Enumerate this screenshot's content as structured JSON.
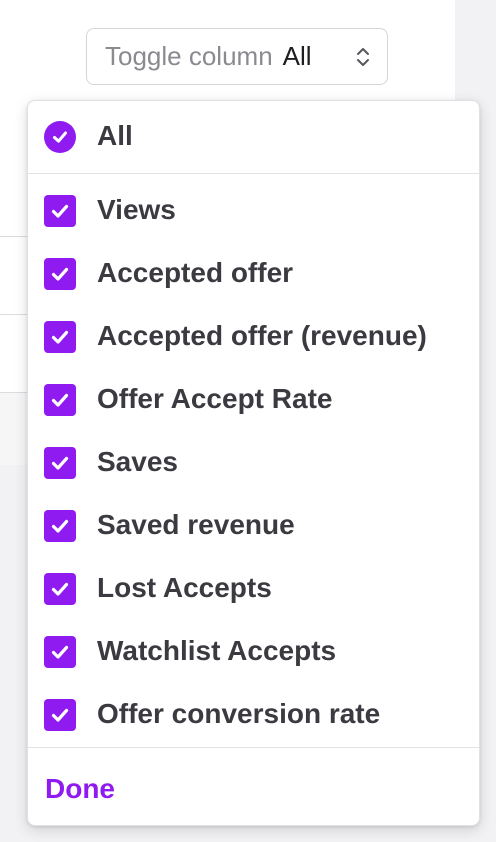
{
  "toggle": {
    "label": "Toggle column",
    "value": "All"
  },
  "dropdown": {
    "all_label": "All",
    "all_checked": true,
    "options": [
      {
        "label": "Views",
        "checked": true
      },
      {
        "label": "Accepted offer",
        "checked": true
      },
      {
        "label": "Accepted offer (revenue)",
        "checked": true
      },
      {
        "label": "Offer Accept Rate",
        "checked": true
      },
      {
        "label": "Saves",
        "checked": true
      },
      {
        "label": "Saved revenue",
        "checked": true
      },
      {
        "label": "Lost Accepts",
        "checked": true
      },
      {
        "label": "Watchlist Accepts",
        "checked": true
      },
      {
        "label": "Offer conversion rate",
        "checked": true
      }
    ],
    "done_label": "Done"
  },
  "colors": {
    "accent": "#8f1bf1",
    "text": "#3a3a40",
    "muted": "#8a8a90"
  },
  "icons": {
    "all": "check-circle-icon",
    "option": "checkbox-checked-icon",
    "toggle": "chevron-up-down-icon"
  }
}
